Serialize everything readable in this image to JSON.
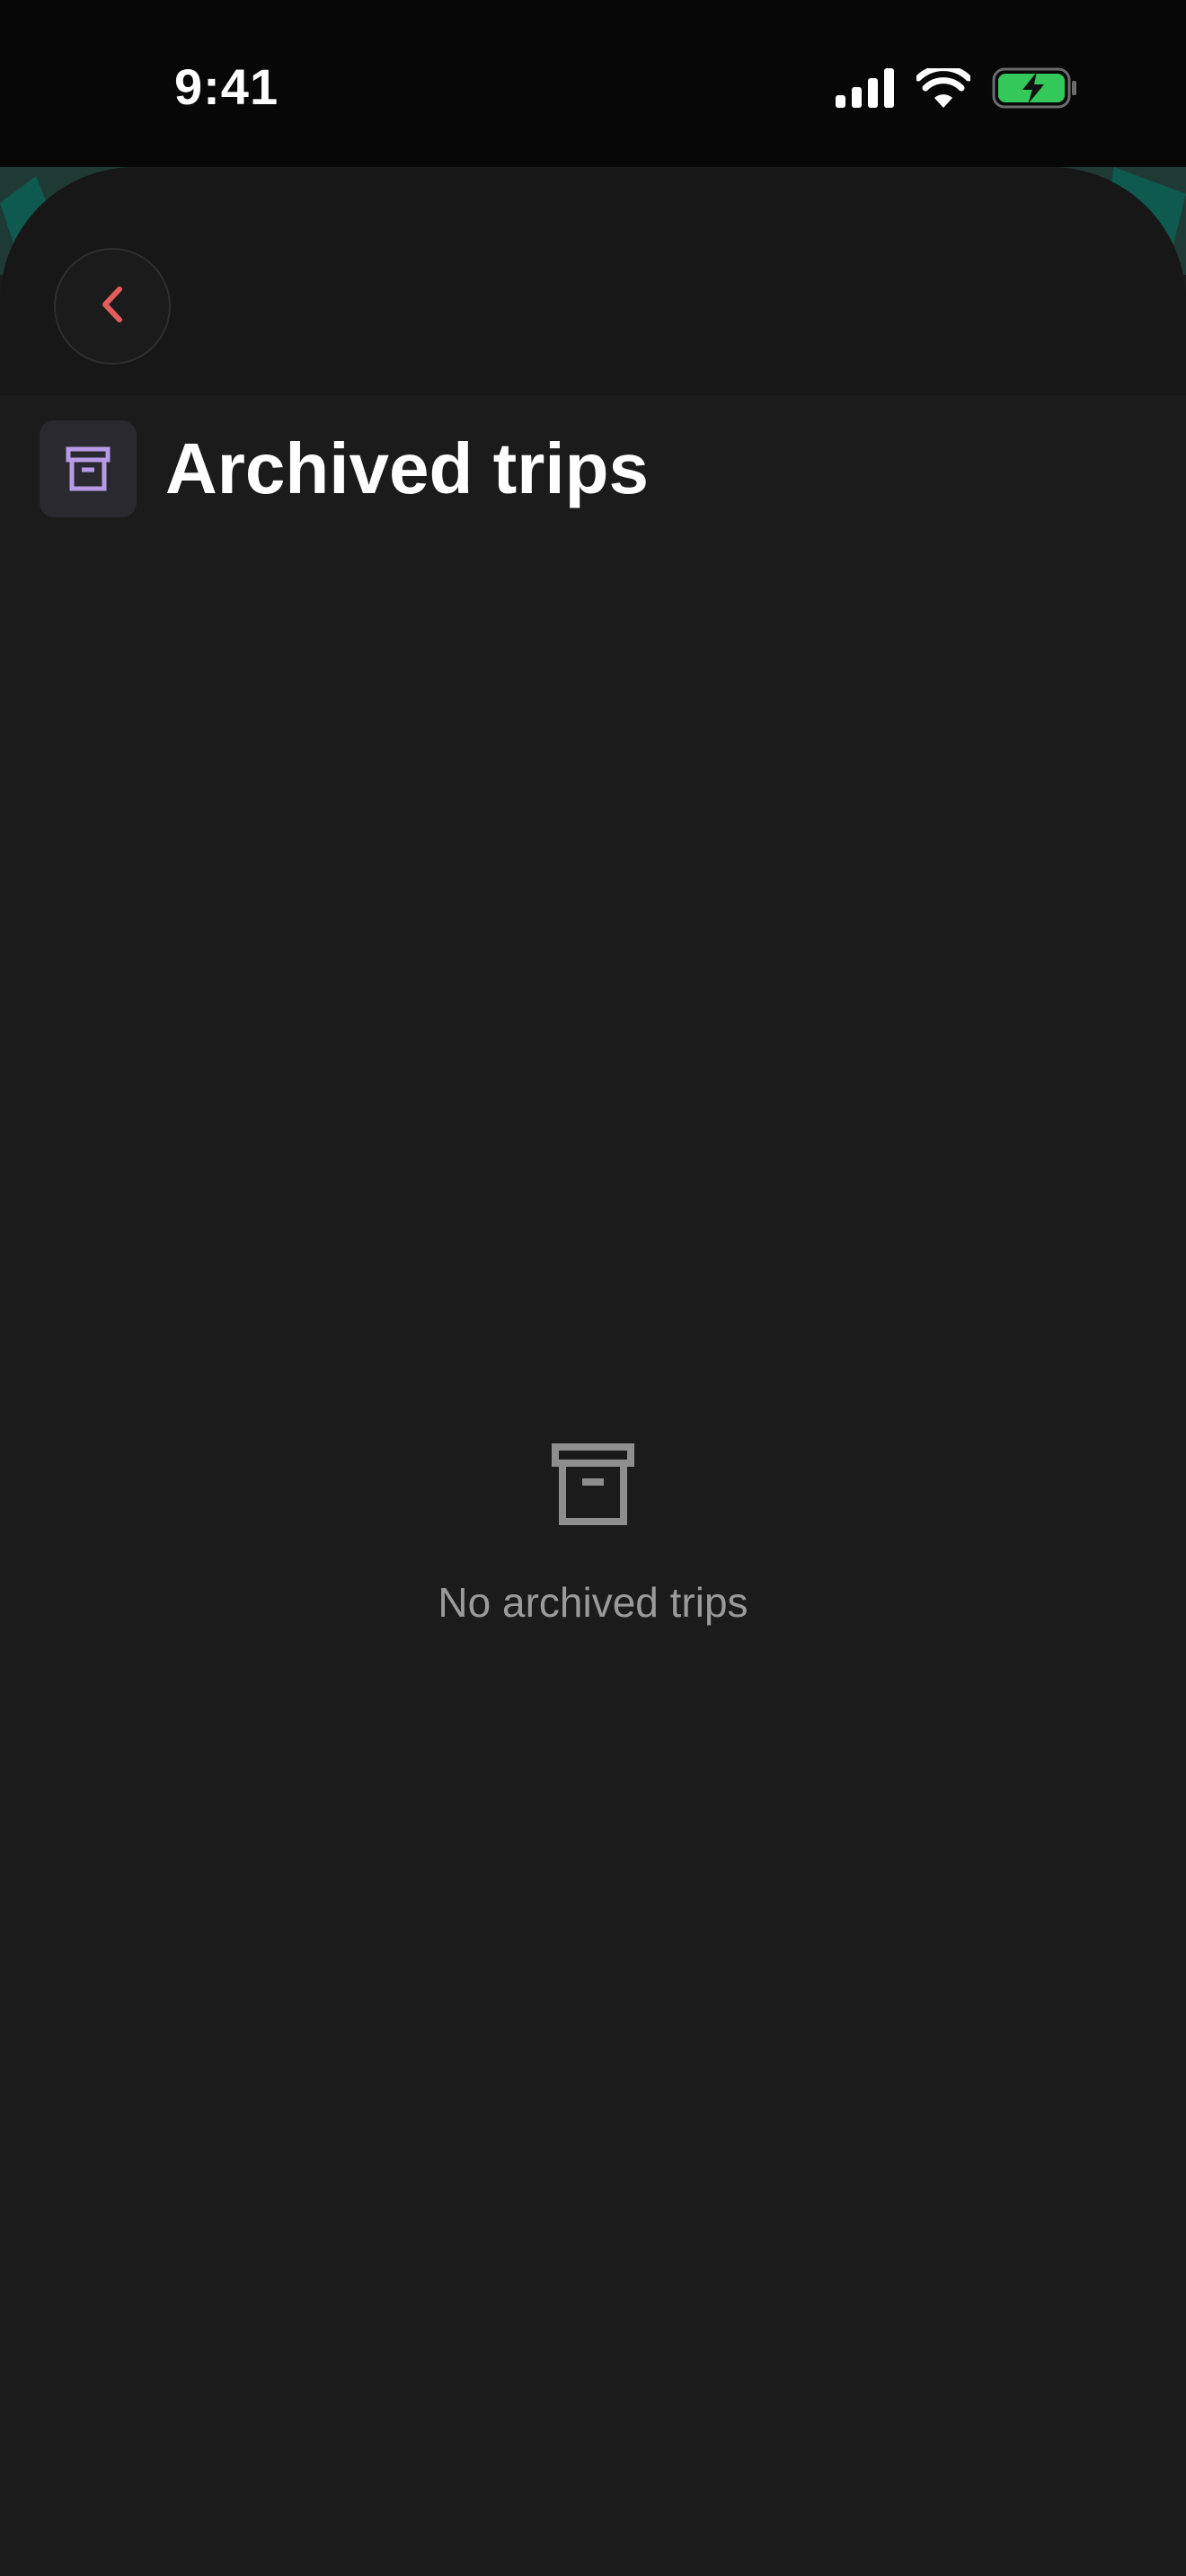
{
  "status_bar": {
    "time": "9:41",
    "signal_icon": "cellular-signal-icon",
    "wifi_icon": "wifi-icon",
    "battery_icon": "battery-charging-icon"
  },
  "header": {
    "back_icon": "chevron-left-icon",
    "title": "Archived trips",
    "title_icon": "archive-box-icon"
  },
  "empty_state": {
    "icon": "archive-box-icon",
    "message": "No archived trips"
  },
  "colors": {
    "accent_back": "#e35d5d",
    "title_icon": "#b79be6",
    "battery_fill": "#34c759",
    "empty_icon": "#8e8e8e",
    "background": "#1b1b1b"
  }
}
